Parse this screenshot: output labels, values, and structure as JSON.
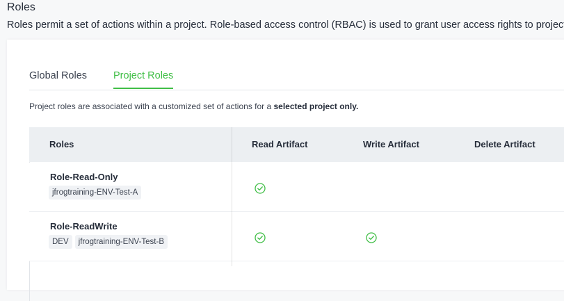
{
  "header": {
    "title": "Roles",
    "description": "Roles permit a set of actions within a project. Role-based access control (RBAC) is used to grant user access rights to project"
  },
  "tabs": [
    {
      "label": "Global Roles",
      "active": false
    },
    {
      "label": "Project Roles",
      "active": true
    }
  ],
  "info": {
    "prefix": "Project roles are associated with a customized set of actions for a ",
    "emphasis": "selected project only."
  },
  "table": {
    "columns": [
      "Roles",
      "Read Artifact",
      "Write Artifact",
      "Delete Artifact"
    ],
    "rows": [
      {
        "name": "Role-Read-Only",
        "tags": [
          "jfrogtraining-ENV-Test-A"
        ],
        "read": true,
        "write": false,
        "delete": false
      },
      {
        "name": "Role-ReadWrite",
        "tags": [
          "DEV",
          "jfrogtraining-ENV-Test-B"
        ],
        "read": true,
        "write": true,
        "delete": false
      }
    ]
  },
  "colors": {
    "accent": "#40be46",
    "header_bg": "#eceff2"
  },
  "icons": {
    "check": "check-circle-icon"
  }
}
